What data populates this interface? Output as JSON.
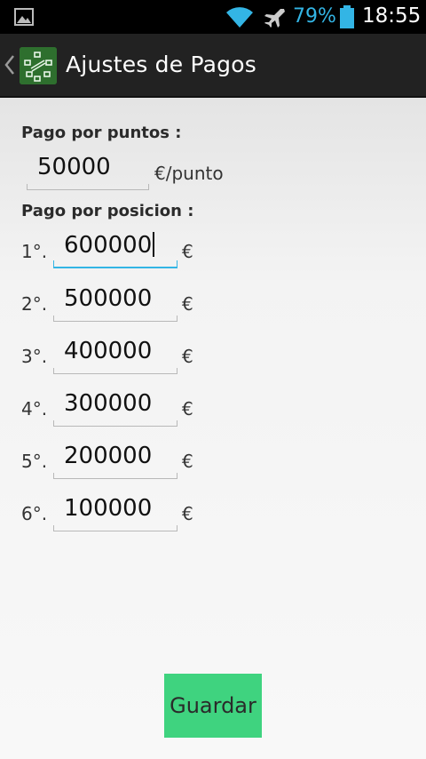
{
  "status_bar": {
    "battery_percent": "79%",
    "time": "18:55",
    "icons": [
      "image-icon",
      "wifi-icon",
      "airplane-icon",
      "battery-icon"
    ],
    "accent_color": "#33b5e5"
  },
  "action_bar": {
    "title": "Ajustes de Pagos",
    "back_icon": "chevron-left-icon",
    "app_icon": "app-logo-icon"
  },
  "points": {
    "label": "Pago por puntos :",
    "value": "50000",
    "unit": "€/punto"
  },
  "position": {
    "label": "Pago por posicion :",
    "rows": [
      {
        "rank": "1°.",
        "value": "600000",
        "unit": "€",
        "focused": true
      },
      {
        "rank": "2°.",
        "value": "500000",
        "unit": "€"
      },
      {
        "rank": "3°.",
        "value": "400000",
        "unit": "€"
      },
      {
        "rank": "4°.",
        "value": "300000",
        "unit": "€"
      },
      {
        "rank": "5°.",
        "value": "200000",
        "unit": "€"
      },
      {
        "rank": "6°.",
        "value": "100000",
        "unit": "€"
      }
    ]
  },
  "save_button": {
    "label": "Guardar",
    "color": "#3fd37f"
  }
}
